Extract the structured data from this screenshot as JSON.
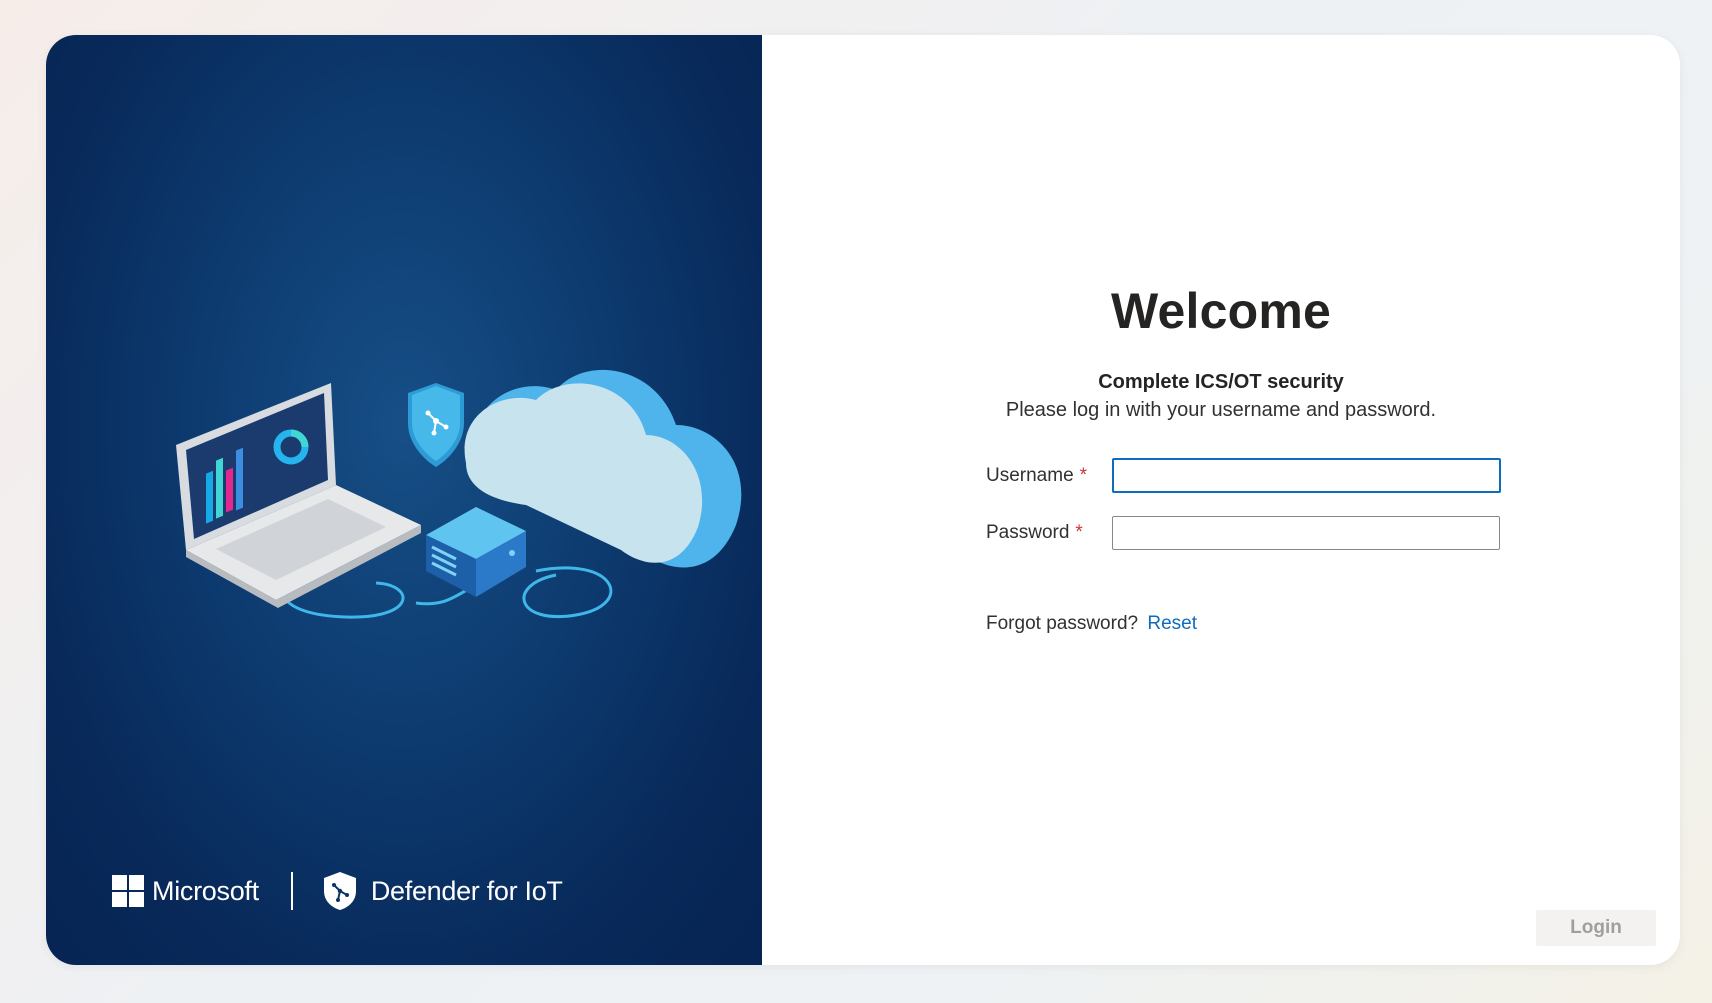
{
  "brand": {
    "company": "Microsoft",
    "product": "Defender for IoT"
  },
  "login": {
    "title": "Welcome",
    "subtitle": "Complete ICS/OT security",
    "instructions": "Please log in with your username and password.",
    "username_label": "Username",
    "username_value": "",
    "password_label": "Password",
    "password_value": "",
    "required_marker": "*",
    "forgot_text": "Forgot password?",
    "reset_link": "Reset",
    "login_button": "Login"
  },
  "colors": {
    "panel_dark": "#0b3466",
    "accent_blue": "#0f6cbd",
    "required_red": "#d13438",
    "disabled_button_bg": "#f3f2f1",
    "disabled_button_text": "#a19f9d"
  },
  "icons": {
    "brand_logo": "microsoft-logo",
    "product_logo": "shield-icon",
    "illustration": "laptop-cloud-server-illustration"
  }
}
